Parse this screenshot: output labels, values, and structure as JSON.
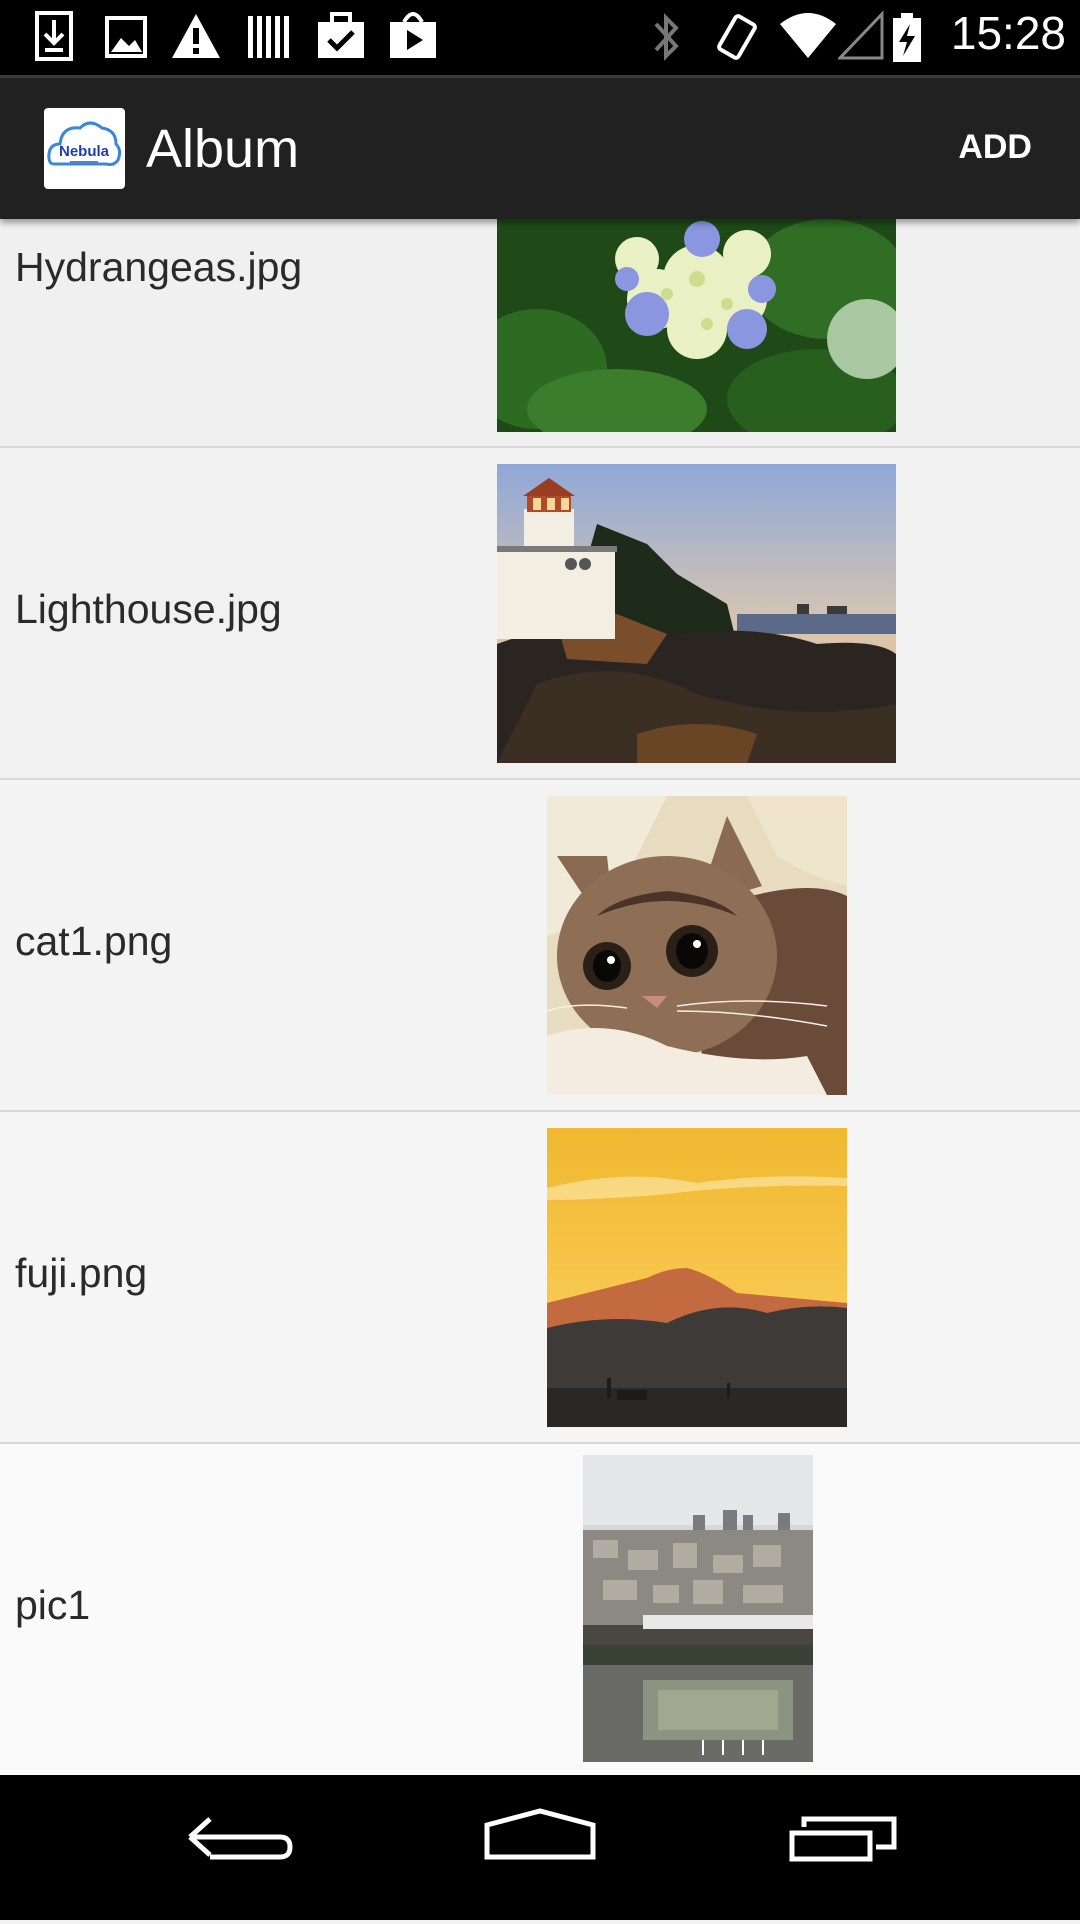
{
  "status_bar": {
    "time": "15:28",
    "left_icons": [
      "download-icon",
      "image-icon",
      "warning-icon",
      "barcode-icon",
      "briefcase-check-icon",
      "play-store-icon"
    ],
    "right_icons": [
      "bluetooth-icon",
      "vibrate-icon",
      "wifi-icon",
      "signal-icon",
      "battery-charging-icon"
    ]
  },
  "action_bar": {
    "logo_text": "Nebula",
    "title": "Album",
    "add_label": "ADD"
  },
  "album": {
    "items": [
      {
        "label": "Hydrangeas.jpg",
        "image": "hydrangeas-thumbnail"
      },
      {
        "label": "Lighthouse.jpg",
        "image": "lighthouse-thumbnail"
      },
      {
        "label": "cat1.png",
        "image": "cat-thumbnail"
      },
      {
        "label": "fuji.png",
        "image": "fuji-thumbnail"
      },
      {
        "label": "pic1",
        "image": "city-thumbnail"
      }
    ]
  },
  "nav_bar": {
    "buttons": [
      "back-icon",
      "home-icon",
      "recent-apps-icon"
    ]
  }
}
